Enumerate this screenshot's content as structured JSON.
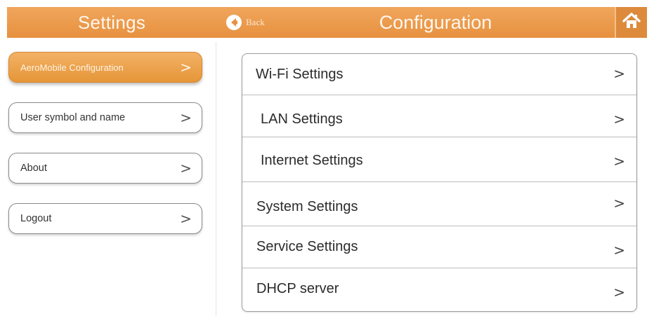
{
  "header": {
    "left_title": "Settings",
    "back_label": "Back",
    "title": "Configuration",
    "home_icon": "home-icon"
  },
  "colors": {
    "accent": "#e99a48",
    "accent_dark": "#d8862f",
    "border": "#9d9d9d"
  },
  "sidebar": {
    "items": [
      {
        "label": "AeroMobile Configuration",
        "active": true,
        "chevron": ">"
      },
      {
        "label": "User symbol and name",
        "active": false,
        "chevron": ">"
      },
      {
        "label": "About",
        "active": false,
        "chevron": ">"
      },
      {
        "label": "Logout",
        "active": false,
        "chevron": ">"
      }
    ]
  },
  "config": {
    "items": [
      {
        "label": "Wi-Fi Settings",
        "chevron": ">"
      },
      {
        "label": "LAN Settings",
        "chevron": ">"
      },
      {
        "label": "Internet Settings",
        "chevron": ">"
      },
      {
        "label": "System Settings",
        "chevron": ">"
      },
      {
        "label": "Service Settings",
        "chevron": ">"
      },
      {
        "label": "DHCP server",
        "chevron": ">"
      }
    ]
  }
}
